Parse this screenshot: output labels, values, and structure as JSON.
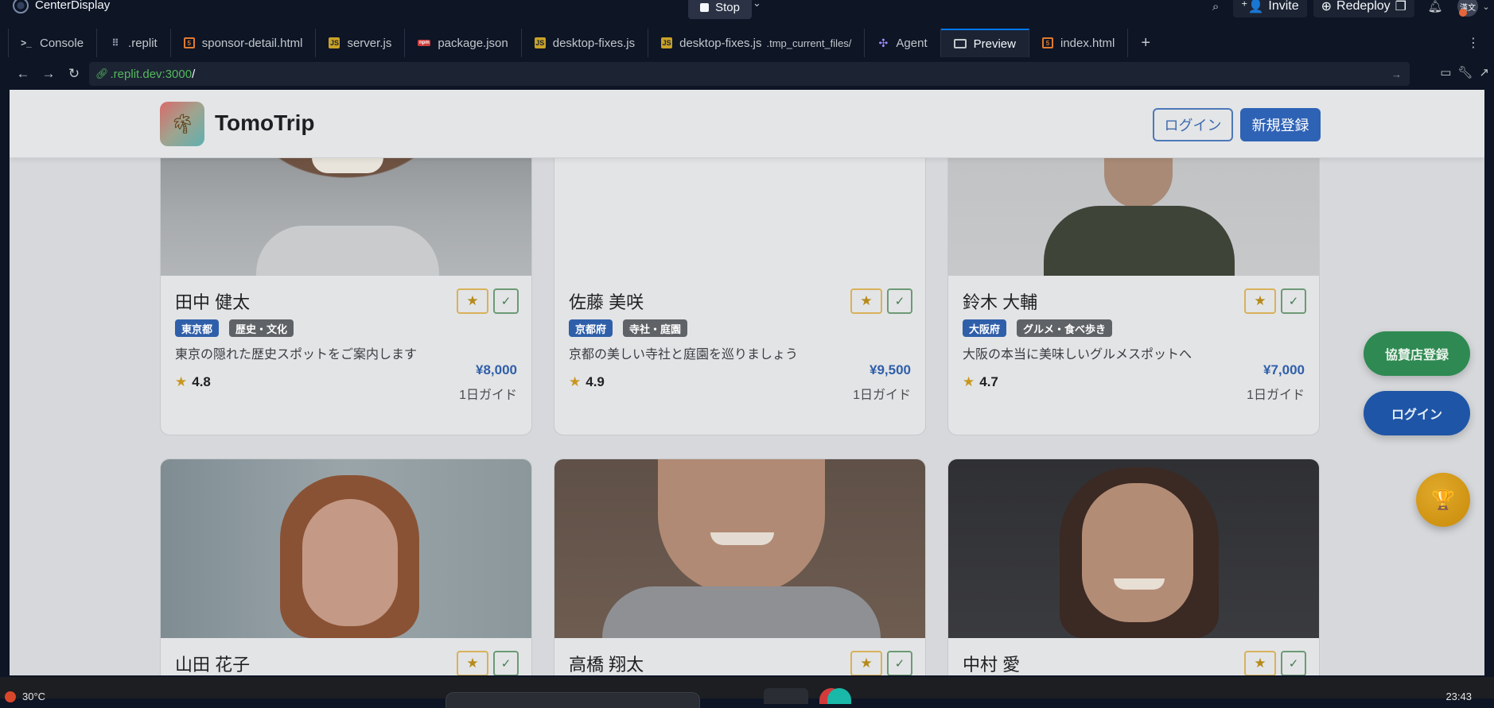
{
  "app": {
    "title": "CenterDisplay"
  },
  "topbar": {
    "run_label": "Stop",
    "invite_label": "Invite",
    "redeploy_label": "Redeploy",
    "avatar_text": "漢文"
  },
  "tabs": [
    {
      "label": "Console",
      "icon": "terminal-icon"
    },
    {
      "label": ".replit",
      "icon": "config-icon"
    },
    {
      "label": "sponsor-detail.html",
      "icon": "html-file-icon"
    },
    {
      "label": "server.js",
      "icon": "js-file-icon"
    },
    {
      "label": "package.json",
      "icon": "json-file-icon"
    },
    {
      "label": "desktop-fixes.js",
      "icon": "js-file-icon"
    },
    {
      "label": "desktop-fixes.js",
      "sub": ".tmp_current_files/",
      "icon": "js-file-icon"
    },
    {
      "label": "Agent",
      "icon": "agent-icon"
    },
    {
      "label": "Preview",
      "icon": "monitor-icon",
      "active": true
    },
    {
      "label": "index.html",
      "icon": "html-file-icon"
    }
  ],
  "address": {
    "host": ".replit.dev:3000",
    "path": "/"
  },
  "site": {
    "brand": "TomoTrip",
    "login_label": "ログイン",
    "signup_label": "新規登録",
    "fab_sponsor": "協賛店登録",
    "fab_login": "ログイン",
    "fab_trophy_icon": "🏆"
  },
  "guides": [
    {
      "name": "田中 健太",
      "region": "東京都",
      "topic": "歴史・文化",
      "desc": "東京の隠れた歴史スポットをご案内します",
      "rating": "4.8",
      "price": "¥8,000",
      "duration": "1日ガイド"
    },
    {
      "name": "佐藤 美咲",
      "region": "京都府",
      "topic": "寺社・庭園",
      "desc": "京都の美しい寺社と庭園を巡りましょう",
      "rating": "4.9",
      "price": "¥9,500",
      "duration": "1日ガイド"
    },
    {
      "name": "鈴木 大輔",
      "region": "大阪府",
      "topic": "グルメ・食べ歩き",
      "desc": "大阪の本当に美味しいグルメスポットへ",
      "rating": "4.7",
      "price": "¥7,000",
      "duration": "1日ガイド"
    },
    {
      "name": "山田 花子"
    },
    {
      "name": "高橋 翔太"
    },
    {
      "name": "中村 愛"
    }
  ],
  "icons": {
    "star": "★",
    "check": "✓",
    "fav": "⭐"
  },
  "taskbar": {
    "weather": "30°C",
    "time": "23:43"
  },
  "colors": {
    "accent": "#0079f2",
    "price": "#2f5fa9",
    "sponsor_green": "#2e8a52"
  }
}
